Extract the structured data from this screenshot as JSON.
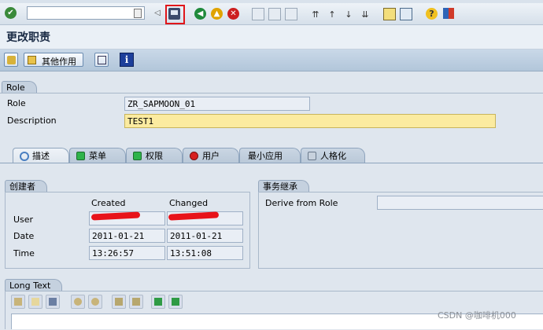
{
  "top_strip": {
    "cut_text": "＿ ＿ ＿ ＿ ＿ ＿ ＿ ＿ ＿ ＿ ＿ ＿ ＿ ＿"
  },
  "toolbar": {
    "command_value": "",
    "icons": [
      "enter-icon",
      "save-icon",
      "back-icon",
      "exit-icon",
      "cancel-icon",
      "print-icon",
      "find-icon",
      "find-next-icon",
      "first-page-icon",
      "prev-page-icon",
      "next-page-icon",
      "last-page-icon",
      "create-session-icon",
      "shortcut-icon",
      "help-icon",
      "layout-icon"
    ]
  },
  "title": {
    "text": "更改职责"
  },
  "app_toolbar": {
    "other_action_label": "其他作用"
  },
  "role_section": {
    "title": "Role",
    "fields": [
      {
        "label": "Role",
        "value": "ZR_SAPMOON_01"
      },
      {
        "label": "Description",
        "value": "TEST1"
      }
    ]
  },
  "tabs": [
    {
      "label": "描述",
      "icon": "magnifier-icon",
      "color": "#4a7fc1",
      "active": true
    },
    {
      "label": "菜单",
      "icon": "status-green-icon",
      "color": "#2fb34a",
      "active": false
    },
    {
      "label": "权限",
      "icon": "status-green-icon",
      "color": "#2fb34a",
      "active": false
    },
    {
      "label": "用户",
      "icon": "status-red-icon",
      "color": "#d62020",
      "active": false
    },
    {
      "label": "最小应用",
      "icon": "",
      "color": "",
      "active": false
    },
    {
      "label": "人格化",
      "icon": "personalize-icon",
      "color": "#6a7a8c",
      "active": false
    }
  ],
  "creator": {
    "title": "创建者",
    "col_created": "Created",
    "col_changed": "Changed",
    "rows": [
      {
        "label": "User",
        "created": "",
        "changed": ""
      },
      {
        "label": "Date",
        "created": "2011-01-21",
        "changed": "2011-01-21"
      },
      {
        "label": "Time",
        "created": "13:26:57",
        "changed": "13:51:08"
      }
    ]
  },
  "inheritance": {
    "title": "事务继承",
    "derive_label": "Derive from Role",
    "derive_value": ""
  },
  "long_text": {
    "title": "Long Text"
  },
  "watermark": "CSDN @咖啡机000"
}
